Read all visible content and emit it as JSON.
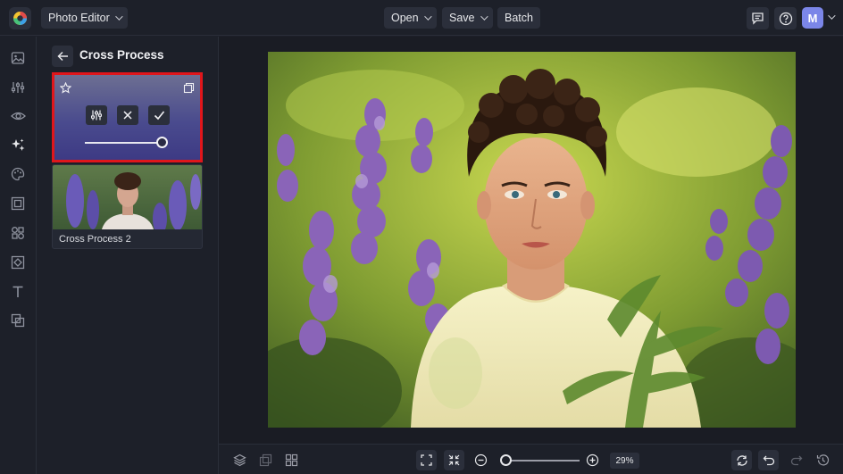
{
  "topbar": {
    "app_menu_label": "Photo Editor",
    "open_label": "Open",
    "save_label": "Save",
    "batch_label": "Batch",
    "avatar_initial": "M"
  },
  "rail": {
    "items": [
      "image-icon",
      "adjust-icon",
      "eye-icon",
      "effects-icon",
      "palette-icon",
      "frame-icon",
      "graphics-icon",
      "texture-icon",
      "text-icon",
      "overlay-icon"
    ],
    "active": "effects-icon"
  },
  "panel": {
    "title": "Cross Process",
    "effect_card": {
      "controls": [
        "sliders-icon",
        "close-icon",
        "check-icon"
      ],
      "intensity": 1.0,
      "highlight_color": "#e0161b"
    },
    "presets": [
      {
        "label": "Cross Process 2"
      }
    ]
  },
  "bottombar": {
    "zoom_value": "29%",
    "zoom_fraction": 0.06
  },
  "colors": {
    "accent": "#7b86e8",
    "highlight": "#e0161b",
    "background": "#1d2029"
  }
}
